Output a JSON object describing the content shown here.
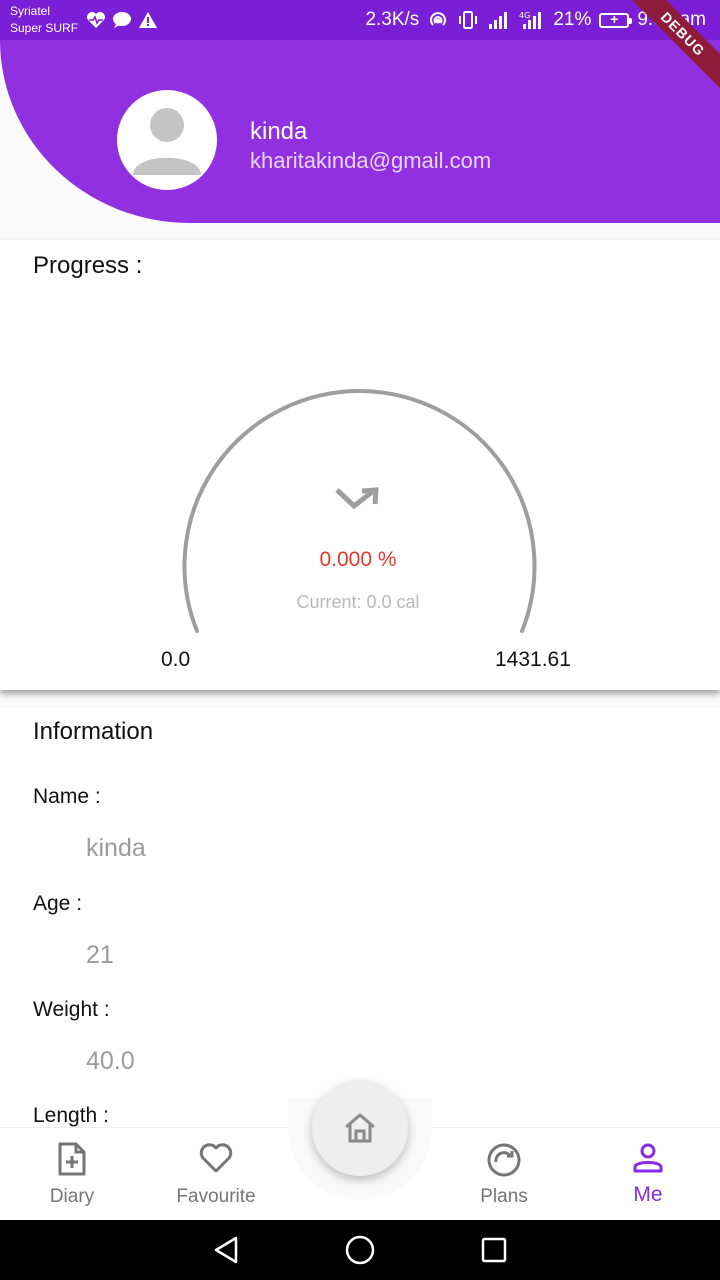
{
  "status_bar": {
    "carrier_line1": "Syriatel",
    "carrier_line2": "Super SURF",
    "speed": "2.3K/s",
    "battery": "21%",
    "time": "9:00 am"
  },
  "debug_banner": "DEBUG",
  "profile": {
    "name": "kinda",
    "email": "kharitakinda@gmail.com",
    "avatar_icon": "person-icon"
  },
  "progress": {
    "title": "Progress :",
    "percent_text": "0.000 %",
    "current_text": "Current: 0.0 cal",
    "min_label": "0.0",
    "max_label": "1431.61",
    "value_fraction": 0.0,
    "trend_icon": "trending-down-icon",
    "colors": {
      "arc": "#9e9e9e",
      "percent": "#e8382b"
    }
  },
  "information": {
    "title": "Information",
    "fields": [
      {
        "label": "Name :",
        "value": "kinda"
      },
      {
        "label": "Age :",
        "value": "21"
      },
      {
        "label": "Weight :",
        "value": "40.0"
      },
      {
        "label": "Length :",
        "value": ""
      }
    ]
  },
  "bottom_nav": {
    "items": [
      {
        "label": "Diary",
        "icon": "note-add-icon"
      },
      {
        "label": "Favourite",
        "icon": "heart-icon"
      },
      {
        "label": "Plans",
        "icon": "refresh-circle-icon"
      },
      {
        "label": "Me",
        "icon": "person-outline-icon",
        "active": true
      }
    ],
    "home_icon": "home-icon",
    "active_color": "#8a2be2"
  },
  "colors": {
    "header": "#9130e0",
    "statusbar": "#7b1fd6"
  }
}
